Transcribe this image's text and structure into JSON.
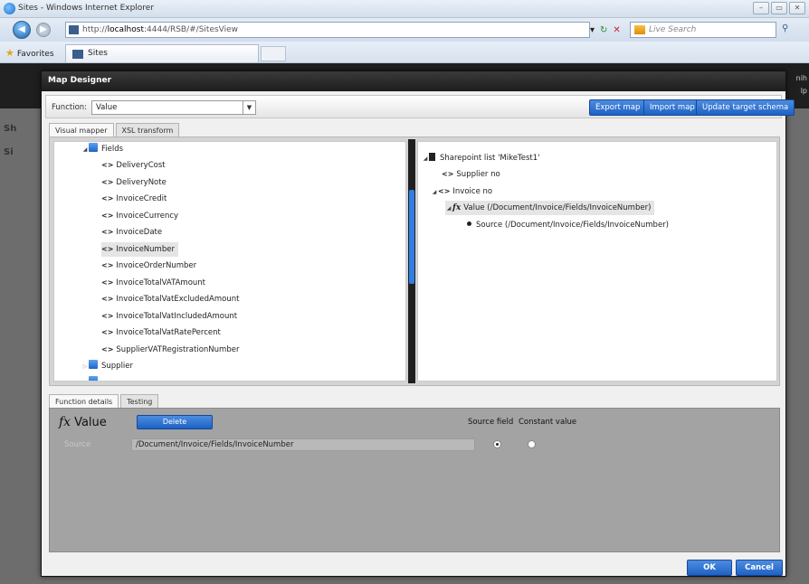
{
  "browser": {
    "window_title": "Sites - Windows Internet Explorer",
    "address_host": "localhost",
    "address_prefix": "http://",
    "address_rest": ":4444/RSB/#/SitesView",
    "search_placeholder": "Live Search",
    "favorites_label": "Favorites",
    "tab_label": "Sites"
  },
  "page": {
    "right_lines": [
      "nih",
      "lp"
    ],
    "left_letters": [
      "Sh",
      "Si"
    ]
  },
  "dialog": {
    "title": "Map Designer",
    "function_label": "Function:",
    "function_value": "Value",
    "buttons": {
      "export": "Export map",
      "import": "Import map",
      "update": "Update target schema"
    },
    "tabs": [
      "Visual mapper",
      "XSL transform"
    ],
    "left_tree": {
      "fields_folder": "Fields",
      "fields": [
        "DeliveryCost",
        "DeliveryNote",
        "InvoiceCredit",
        "InvoiceCurrency",
        "InvoiceDate",
        "InvoiceNumber",
        "InvoiceOrderNumber",
        "InvoiceTotalVATAmount",
        "InvoiceTotalVatExcludedAmount",
        "InvoiceTotalVatIncludedAmount",
        "InvoiceTotalVatRatePercent",
        "SupplierVATRegistrationNumber"
      ],
      "selected_field": "InvoiceNumber",
      "supplier_folder": "Supplier"
    },
    "right_tree": {
      "root": "Sharepoint list 'MikeTest1'",
      "supplier_no": "Supplier no",
      "invoice_no": "Invoice no",
      "fx_value": "Value (/Document/Invoice/Fields/InvoiceNumber)",
      "source": "Source (/Document/Invoice/Fields/InvoiceNumber)"
    },
    "details_tabs": [
      "Function details",
      "Testing"
    ],
    "details": {
      "fx_symbol": "fx",
      "fx_name": "Value",
      "delete_label": "Delete",
      "source_field_header": "Source field",
      "constant_value_header": "Constant value",
      "source_label": "Source",
      "source_value": "/Document/Invoice/Fields/InvoiceNumber",
      "selected_option": "Source field"
    },
    "ok_label": "OK",
    "cancel_label": "Cancel"
  }
}
